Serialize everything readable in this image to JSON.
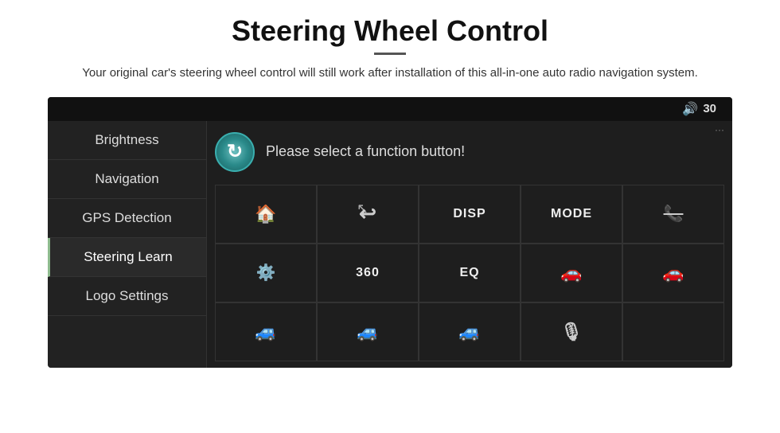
{
  "page": {
    "title": "Steering Wheel Control",
    "subtitle": "Your original car's steering wheel control will still work after installation of this all-in-one auto radio navigation system."
  },
  "topbar": {
    "volume_icon": "🔊",
    "volume_value": "30"
  },
  "sidebar": {
    "items": [
      {
        "label": "Brightness",
        "active": false
      },
      {
        "label": "Navigation",
        "active": false
      },
      {
        "label": "GPS Detection",
        "active": false
      },
      {
        "label": "Steering Learn",
        "active": true
      },
      {
        "label": "Logo Settings",
        "active": false
      }
    ]
  },
  "content": {
    "prompt": "Please select a function button!",
    "refresh_icon": "↻",
    "buttons": [
      {
        "row": 1,
        "col": 1,
        "type": "icon",
        "label": "🏠",
        "name": "home"
      },
      {
        "row": 1,
        "col": 2,
        "type": "icon",
        "label": "↩",
        "name": "back"
      },
      {
        "row": 1,
        "col": 3,
        "type": "text",
        "label": "DISP",
        "name": "disp"
      },
      {
        "row": 1,
        "col": 4,
        "type": "text",
        "label": "MODE",
        "name": "mode"
      },
      {
        "row": 1,
        "col": 5,
        "type": "icon",
        "label": "🚫📞",
        "name": "call-cancel"
      },
      {
        "row": 2,
        "col": 1,
        "type": "icon",
        "label": "⚙",
        "name": "settings"
      },
      {
        "row": 2,
        "col": 2,
        "type": "text",
        "label": "360",
        "name": "360"
      },
      {
        "row": 2,
        "col": 3,
        "type": "text",
        "label": "EQ",
        "name": "eq"
      },
      {
        "row": 2,
        "col": 4,
        "type": "icon",
        "label": "🚗",
        "name": "car1"
      },
      {
        "row": 2,
        "col": 5,
        "type": "icon",
        "label": "🚗",
        "name": "car2"
      },
      {
        "row": 3,
        "col": 1,
        "type": "icon",
        "label": "🚘",
        "name": "car3"
      },
      {
        "row": 3,
        "col": 2,
        "type": "icon",
        "label": "🚘",
        "name": "car4"
      },
      {
        "row": 3,
        "col": 3,
        "type": "icon",
        "label": "🚘",
        "name": "car5"
      },
      {
        "row": 3,
        "col": 4,
        "type": "icon",
        "label": "🎙",
        "name": "mic"
      },
      {
        "row": 3,
        "col": 5,
        "type": "icon",
        "label": "",
        "name": "empty"
      }
    ]
  }
}
